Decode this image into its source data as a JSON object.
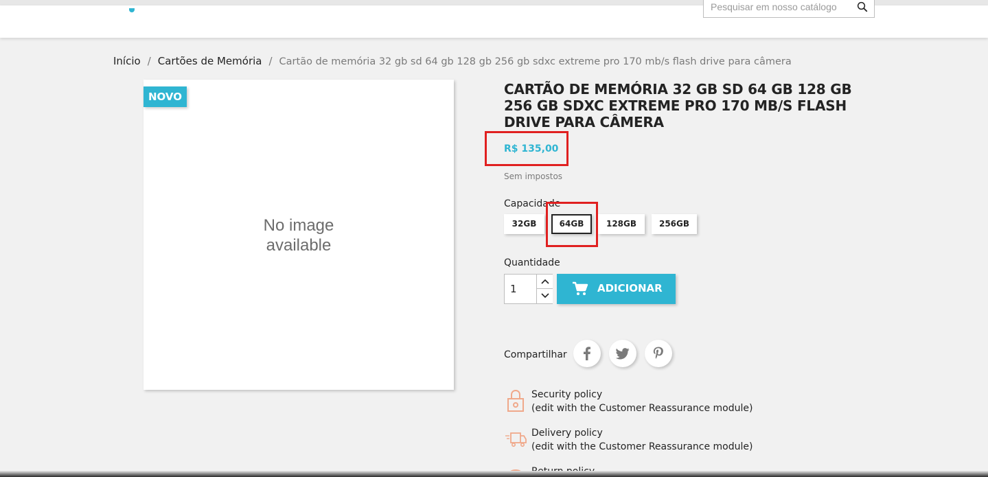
{
  "header": {
    "search_placeholder": "Pesquisar em nosso catálogo"
  },
  "breadcrumb": {
    "items": [
      "Início",
      "Cartões de Memória"
    ],
    "separator": "/",
    "current": "Cartão de memória 32 gb sd 64 gb 128 gb 256 gb sdxc extreme pro 170 mb/s flash drive para câmera"
  },
  "product": {
    "badge": "NOVO",
    "no_image_line1": "No image",
    "no_image_line2": "available",
    "title": "Cartão de memória 32 gb sd 64 gb 128 gb 256 gb sdxc extreme pro 170 mb/s flash drive para câmera",
    "price": "R$ 135,00",
    "tax_label": "Sem impostos",
    "variant_label": "Capacidade",
    "variants": [
      "32GB",
      "64GB",
      "128GB",
      "256GB"
    ],
    "selected_variant": "64GB",
    "quantity_label": "Quantidade",
    "quantity": "1",
    "add_to_cart": "Adicionar",
    "share_label": "Compartilhar",
    "social": [
      "facebook",
      "twitter",
      "pinterest"
    ]
  },
  "reassurance": [
    {
      "title": "Security policy",
      "subtitle": "(edit with the Customer Reassurance module)",
      "icon": "lock-icon"
    },
    {
      "title": "Delivery policy",
      "subtitle": "(edit with the Customer Reassurance module)",
      "icon": "delivery-truck-icon"
    },
    {
      "title": "Return policy",
      "subtitle": "",
      "icon": "return-icon"
    }
  ],
  "colors": {
    "accent": "#2fb5d2",
    "highlight": "#e02020",
    "text": "#232323",
    "muted": "#7a7a7a"
  }
}
